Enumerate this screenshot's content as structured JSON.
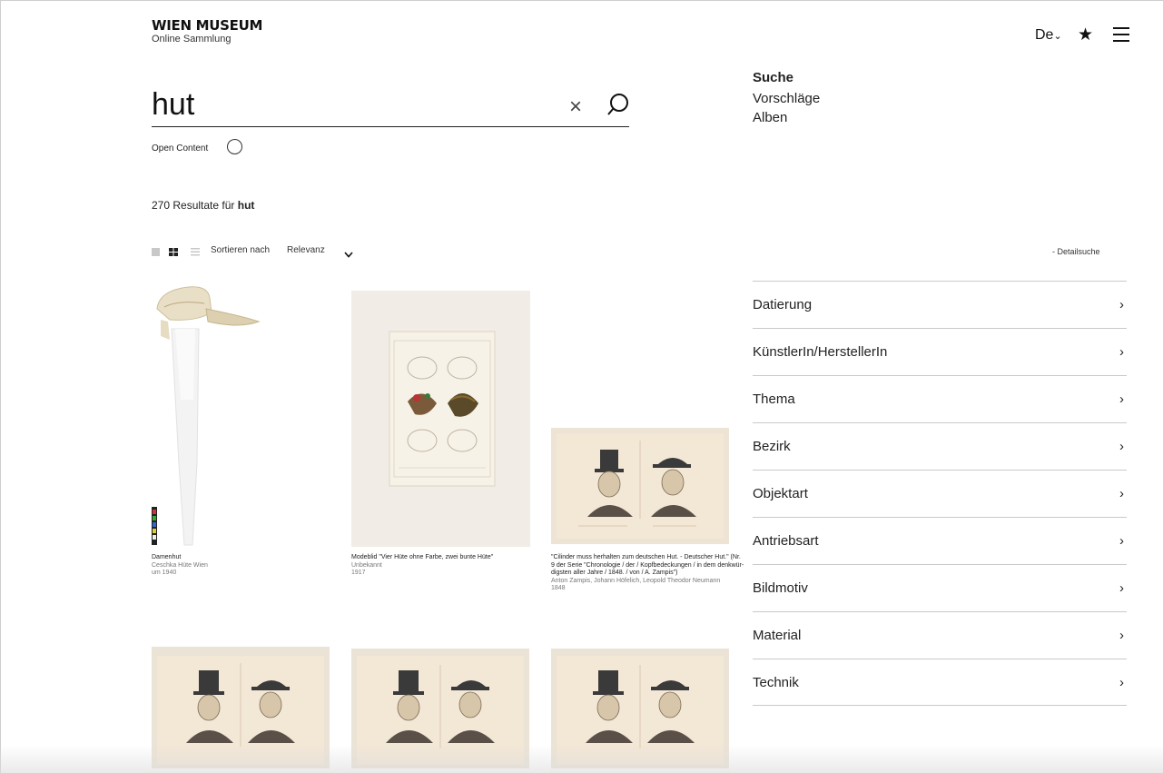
{
  "header": {
    "logo_title": "WIEN MUSEUM",
    "logo_subtitle": "Online Sammlung",
    "language": "De",
    "icons": [
      "chevron-down-icon",
      "star-icon",
      "menu-icon"
    ]
  },
  "nav": {
    "items": [
      "Suche",
      "Vorschläge",
      "Alben"
    ]
  },
  "search": {
    "value": "hut",
    "open_content_label": "Open Content",
    "results_count": "270 Resultate für",
    "results_query": "hut"
  },
  "toolbar": {
    "sort_label": "Sortieren nach",
    "sort_value": "Relevanz",
    "detail_search": "- Detailsuche"
  },
  "filters": [
    "Datierung",
    "KünstlerIn/HerstellerIn",
    "Thema",
    "Bezirk",
    "Objektart",
    "Antriebsart",
    "Bildmotiv",
    "Material",
    "Technik"
  ],
  "results": [
    {
      "title": "Damenhut",
      "creator": "Ceschka Hüte Wien",
      "date": "um 1940"
    },
    {
      "title": "Modeblid \"Vier Hüte ohne Farbe, zwei bunte Hüte\"",
      "creator": "Unbekannt",
      "date": "1917"
    },
    {
      "title": "\"Cilinder muss herhalten zum deutschen Hut. - Deutscher Hut.\" (Nr. 9 der Serie \"Chronologie / der / Kopfbedeckungen / in dem denkwür- digsten aller Jahre / 1848. / von / A. Zampis\")",
      "creator": "Anton Zampis, Johann Höfelich, Leopold Theodor Neumann",
      "date": "1848"
    }
  ],
  "colors": {
    "text": "#111111",
    "divider": "#c9c9c9",
    "paper": "#f1e6d6",
    "background": "#ffffff"
  }
}
